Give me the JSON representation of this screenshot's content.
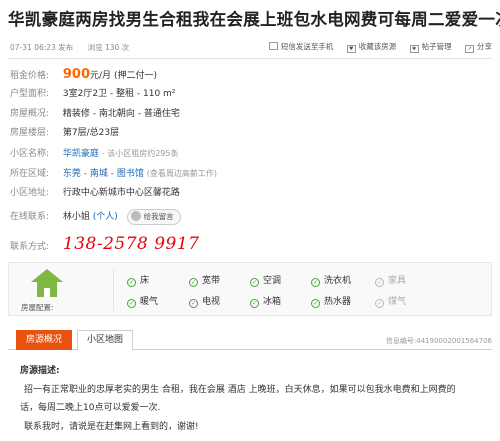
{
  "title": "华凯豪庭两房找男生合租我在会展上班包水电网费可每周二爱爱一次",
  "meta": {
    "date": "07-31 06:23 发布",
    "views": "浏览  130 次",
    "send_to_phone": "短信发送至手机",
    "favorite": "收藏该房源",
    "report": "帖子管理",
    "share": "分享"
  },
  "info": {
    "rent_label": "租金价格:",
    "rent_value": "900",
    "rent_unit": "元/月",
    "rent_note": "(押二付一)",
    "layout_label": "户型面积:",
    "layout_value": "3室2厅2卫 - 整租 - 110 m²",
    "overview_label": "房屋概况:",
    "overview_value": "精装修 - 南北朝向 - 普通住宅",
    "floor_label": "房屋楼层:",
    "floor_value": "第7层/总23层",
    "community_label": "小区名称:",
    "community_value": "华凯豪庭",
    "community_note": "- 该小区租房约295条",
    "area_label": "所在区域:",
    "area_value": "东莞 - 南城 - 图书馆",
    "area_link": "(查看周边高薪工作)",
    "address_label": "小区地址:",
    "address_value": "行政中心新城市中心区馨花路",
    "contact_label": "在线联系:",
    "contact_name": "林小姐",
    "contact_tag": "(个人)",
    "message_btn": "给我留言",
    "phone_label": "联系方式:",
    "phone_value": "138-2578 9917"
  },
  "facilities": {
    "label": "房屋配置:",
    "items": [
      {
        "name": "床",
        "has": true
      },
      {
        "name": "宽带",
        "has": true
      },
      {
        "name": "空调",
        "has": true
      },
      {
        "name": "洗衣机",
        "has": true
      },
      {
        "name": "家具",
        "has": false
      },
      {
        "name": "暖气",
        "has": true
      },
      {
        "name": "电视",
        "has": true
      },
      {
        "name": "冰箱",
        "has": true
      },
      {
        "name": "热水器",
        "has": true
      },
      {
        "name": "煤气",
        "has": false
      }
    ]
  },
  "tabs": {
    "overview": "房源概况",
    "map": "小区地图",
    "code": "信息编号:44190002001564706"
  },
  "description": {
    "heading": "房源描述:",
    "line1": "招一有正常职业的忠厚老实的男生 合租，我在会展 酒店 上晚班，白天休息，如果可以包我水电费和上网费的",
    "line2": "话，每周二晚上10点可以爱爱一次.",
    "line3": "联系我时，请说是在赶集网上看到的，谢谢!"
  },
  "colors": {
    "price": "#ff6600",
    "link": "#1c66b5",
    "phone": "#e8000b",
    "tab_active": "#e8510e",
    "house_icon": "#7fb742"
  }
}
